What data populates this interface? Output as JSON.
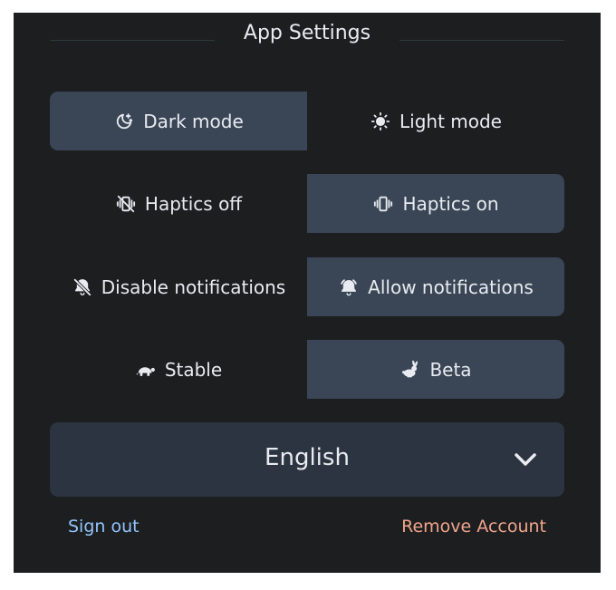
{
  "header": {
    "title": "App Settings"
  },
  "theme": {
    "dark_label": "Dark mode",
    "light_label": "Light mode",
    "selected": "dark"
  },
  "haptics": {
    "off_label": "Haptics off",
    "on_label": "Haptics on",
    "selected": "on"
  },
  "notifications": {
    "disable_label": "Disable notifications",
    "allow_label": "Allow notifications",
    "selected": "allow"
  },
  "channel": {
    "stable_label": "Stable",
    "beta_label": "Beta",
    "selected": "beta"
  },
  "language": {
    "selected": "English"
  },
  "links": {
    "sign_out": "Sign out",
    "remove_account": "Remove Account"
  },
  "colors": {
    "panel_bg": "#1d1e20",
    "selected_bg": "#3a4656",
    "select_bg": "#2b3440",
    "sign_out": "#93c5fd",
    "remove_account": "#f0a58c"
  },
  "icons": {
    "dark": "moon-stars-icon",
    "light": "sun-icon",
    "haptics_off": "vibrate-off-icon",
    "haptics_on": "vibrate-icon",
    "notif_off": "bell-off-icon",
    "notif_on": "bell-ring-icon",
    "stable": "turtle-icon",
    "beta": "rabbit-icon",
    "dropdown": "chevron-down-icon"
  }
}
